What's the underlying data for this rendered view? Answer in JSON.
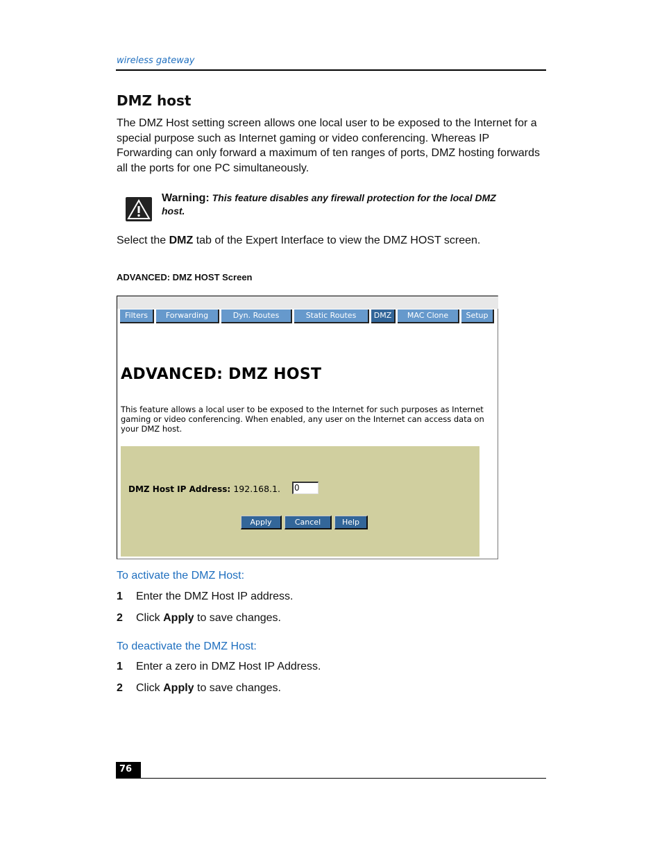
{
  "header": {
    "running_title": "wireless gateway"
  },
  "section": {
    "title": "DMZ host",
    "intro": "The DMZ Host setting screen allows one local user to be exposed to the Internet for a special purpose such as Internet gaming or video conferencing. Whereas IP Forwarding can only forward a maximum of ten ranges of ports, DMZ hosting forwards all the ports for one PC simultaneously."
  },
  "warning": {
    "icon": "warning-triangle-icon",
    "label": "Warning:",
    "text": "This feature disables any firewall protection for the local DMZ host."
  },
  "instruction": {
    "prefix": "Select the ",
    "bold": "DMZ",
    "suffix": " tab of the Expert Interface to view the DMZ HOST screen."
  },
  "figure_caption": "ADVANCED: DMZ HOST Screen",
  "screenshot": {
    "tabs": [
      {
        "label": "Filters",
        "active": false
      },
      {
        "label": "Forwarding",
        "active": false
      },
      {
        "label": "Dyn. Routes",
        "active": false
      },
      {
        "label": "Static Routes",
        "active": false
      },
      {
        "label": "DMZ",
        "active": true
      },
      {
        "label": "MAC Clone",
        "active": false
      },
      {
        "label": "Setup",
        "active": false
      }
    ],
    "title": "ADVANCED: DMZ HOST",
    "description": "This feature allows a local user to be exposed to the Internet for such purposes as Internet gaming or video conferencing. When enabled, any user on the Internet can access data on your DMZ host.",
    "ip_label": "DMZ Host IP Address:",
    "ip_prefix": "192.168.1.",
    "ip_value": "0",
    "buttons": {
      "apply": "Apply",
      "cancel": "Cancel",
      "help": "Help"
    },
    "colors": {
      "tab": "#6699cc",
      "tab_active": "#336699",
      "panel": "#d0cf9f",
      "button": "#336699"
    }
  },
  "activate": {
    "heading": "To activate the DMZ Host:",
    "steps": [
      {
        "num": "1",
        "text": "Enter the DMZ Host IP address."
      },
      {
        "num": "2",
        "pre": "Click ",
        "bold": "Apply",
        "post": " to save changes."
      }
    ]
  },
  "deactivate": {
    "heading": "To deactivate the DMZ Host:",
    "steps": [
      {
        "num": "1",
        "text": "Enter a zero in DMZ Host IP Address."
      },
      {
        "num": "2",
        "pre": "Click ",
        "bold": "Apply",
        "post": " to save changes."
      }
    ]
  },
  "footer": {
    "page_number": "76"
  },
  "colors": {
    "accent": "#1f6fbf"
  }
}
